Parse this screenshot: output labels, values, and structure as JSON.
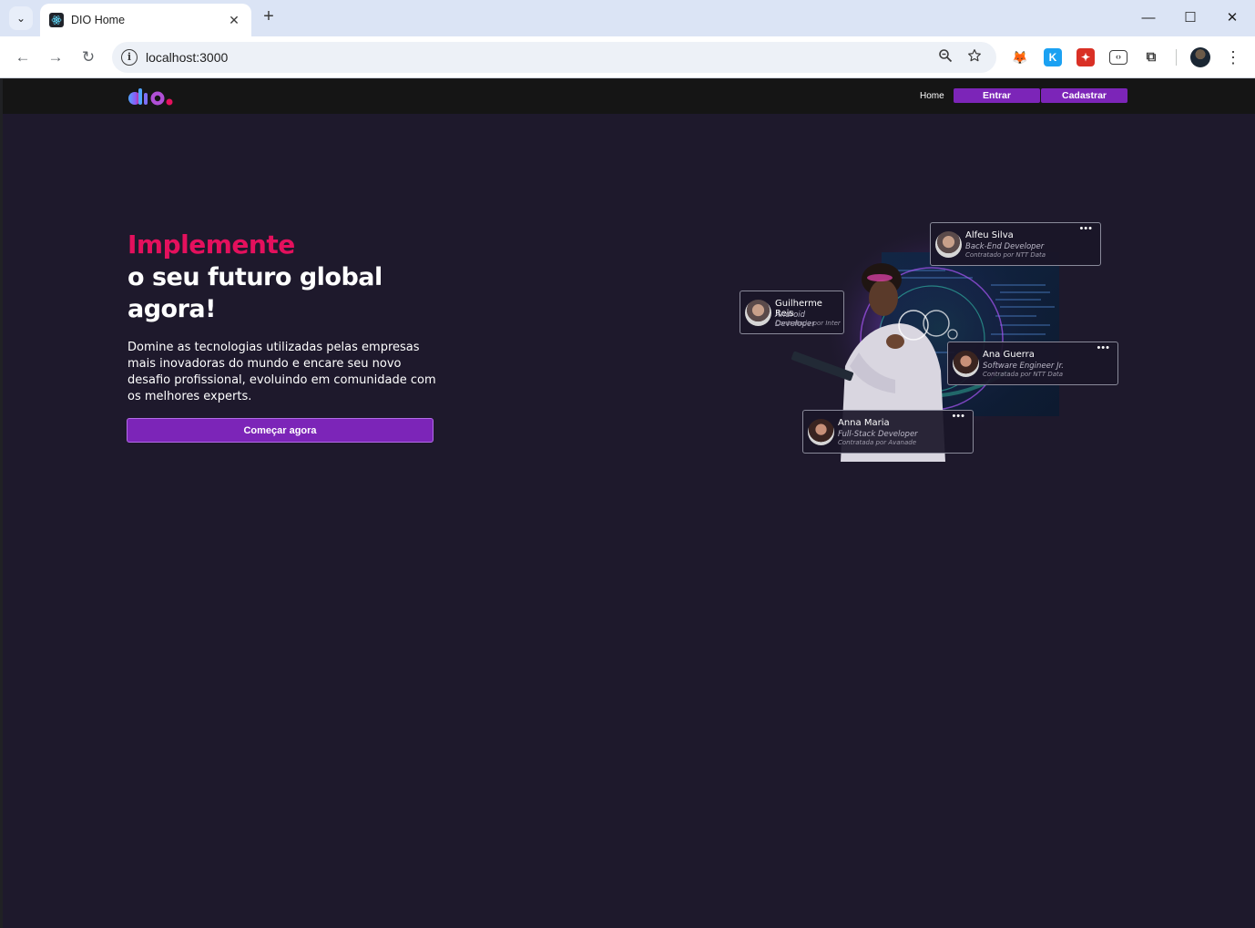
{
  "browser": {
    "tab": {
      "title": "DIO Home",
      "close_glyph": "✕"
    },
    "new_tab_glyph": "+",
    "tab_search_glyph": "⌄",
    "window_controls": {
      "minimize": "—",
      "maximize": "☐",
      "close": "✕"
    },
    "nav": {
      "back": "←",
      "forward": "→",
      "reload": "↻"
    },
    "address": {
      "url": "localhost:3000",
      "info_glyph": "i"
    },
    "omnibox_icons": {
      "zoom": "zoom-icon",
      "bookmark": "bookmark-star-icon"
    },
    "extensions": [
      {
        "name": "metamask-extension-icon",
        "glyph": "🦊",
        "color": "#f6851b"
      },
      {
        "name": "k-extension-icon",
        "glyph": "K",
        "color": "#1ba1f2"
      },
      {
        "name": "red-extension-icon",
        "glyph": "✦",
        "color": "#d93025"
      },
      {
        "name": "devtools-extension-icon",
        "glyph": "‹›",
        "color": "#5f6368"
      },
      {
        "name": "extensions-puzzle-icon",
        "glyph": "⧉",
        "color": "#5f6368"
      }
    ],
    "menu_glyph": "⋮"
  },
  "page": {
    "header": {
      "logo_alt": "dio",
      "nav_home": "Home",
      "login_button": "Entrar",
      "signup_button": "Cadastrar"
    },
    "hero": {
      "title_accent": "Implemente",
      "title_main": "o seu futuro global agora!",
      "description": "Domine as tecnologias utilizadas pelas empresas mais inovadoras do mundo e encare seu novo desafio profissional, evoluindo em comunidade com os melhores experts.",
      "cta_button": "Começar agora"
    },
    "profile_cards": [
      {
        "name": "Alfeu Silva",
        "role": "Back-End Developer",
        "hired": "Contratado por NTT Data"
      },
      {
        "name": "Guilherme Reis",
        "role": "Android Developer",
        "hired": "Contratado por Inter"
      },
      {
        "name": "Ana Guerra",
        "role": "Software Engineer Jr.",
        "hired": "Contratada por NTT Data"
      },
      {
        "name": "Anna Maria",
        "role": "Full-Stack Developer",
        "hired": "Contratada por Avanade"
      }
    ],
    "card_menu_glyph": "•••"
  },
  "colors": {
    "page_background": "#1e192c",
    "header_background": "#151515",
    "accent_pink": "#e4105d",
    "button_purple": "#7c25b8"
  }
}
